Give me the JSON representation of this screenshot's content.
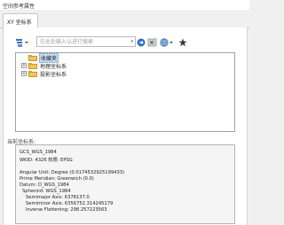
{
  "window": {
    "title": "空间参考属性"
  },
  "tabs": [
    {
      "label": "XY 坐标系"
    }
  ],
  "toolbar": {
    "search_placeholder": "在此处输入以进行搜索",
    "icons": {
      "filter": "filter-icon",
      "search_go": "search-go-icon",
      "clear": "clear-icon",
      "globe": "globe-icon",
      "favorite": "star-icon"
    }
  },
  "tree": {
    "items": [
      {
        "label": "收藏夹",
        "expandable": false,
        "selected": true
      },
      {
        "label": "地理坐标系",
        "expandable": true,
        "selected": false
      },
      {
        "label": "投影坐标系",
        "expandable": true,
        "selected": false
      }
    ]
  },
  "current": {
    "label": "当前坐标系:",
    "lines": [
      "GCS_WGS_1984",
      "WKID: 4326 权限: EPSG",
      "",
      "Angular Unit: Degree (0.0174532925199433)",
      "Prime Meridian: Greenwich (0.0)",
      "Datum: D_WGS_1984",
      "  Spheroid: WGS_1984",
      "    Semimajor Axis: 6378137.0",
      "    Semiminor Axis: 6356752.314245179",
      "    Inverse Flattening: 298.257223563"
    ]
  },
  "colors": {
    "folder": "#f0c75a",
    "selection": "#c8dcf4",
    "accent_blue": "#3a6fb5"
  }
}
